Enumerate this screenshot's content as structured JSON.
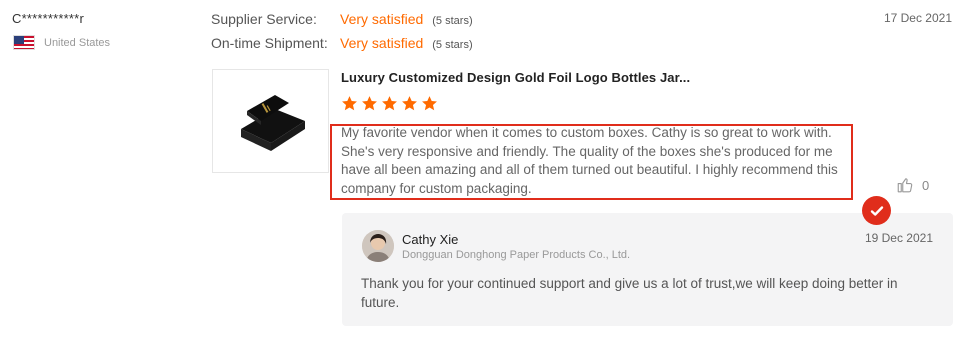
{
  "buyer": {
    "name": "C***********r",
    "country": "United States",
    "flag_icon": "us-flag-icon"
  },
  "ratings": [
    {
      "label": "Supplier Service:",
      "value": "Very satisfied",
      "stars": "(5 stars)"
    },
    {
      "label": "On-time Shipment:",
      "value": "Very satisfied",
      "stars": "(5 stars)"
    }
  ],
  "review": {
    "date": "17 Dec 2021",
    "product_title": "Luxury Customized Design Gold Foil Logo Bottles Jar...",
    "star_rating": 5,
    "text": "My favorite vendor when it comes to custom boxes. Cathy is so great to work with. She's very responsive and friendly. The quality of the boxes she's produced for me have all been amazing and all of them turned out beautiful. I highly recommend this company for custom packaging.",
    "likes": "0"
  },
  "reply": {
    "name": "Cathy Xie",
    "company": "Dongguan Donghong Paper Products Co., Ltd.",
    "date": "19 Dec 2021",
    "text": "Thank you for your continued support and give us a lot of trust,we will keep doing better in future."
  },
  "colors": {
    "accent": "#ff6a00",
    "highlight_border": "#e02d1b",
    "reply_bg": "#f4f4f5"
  }
}
